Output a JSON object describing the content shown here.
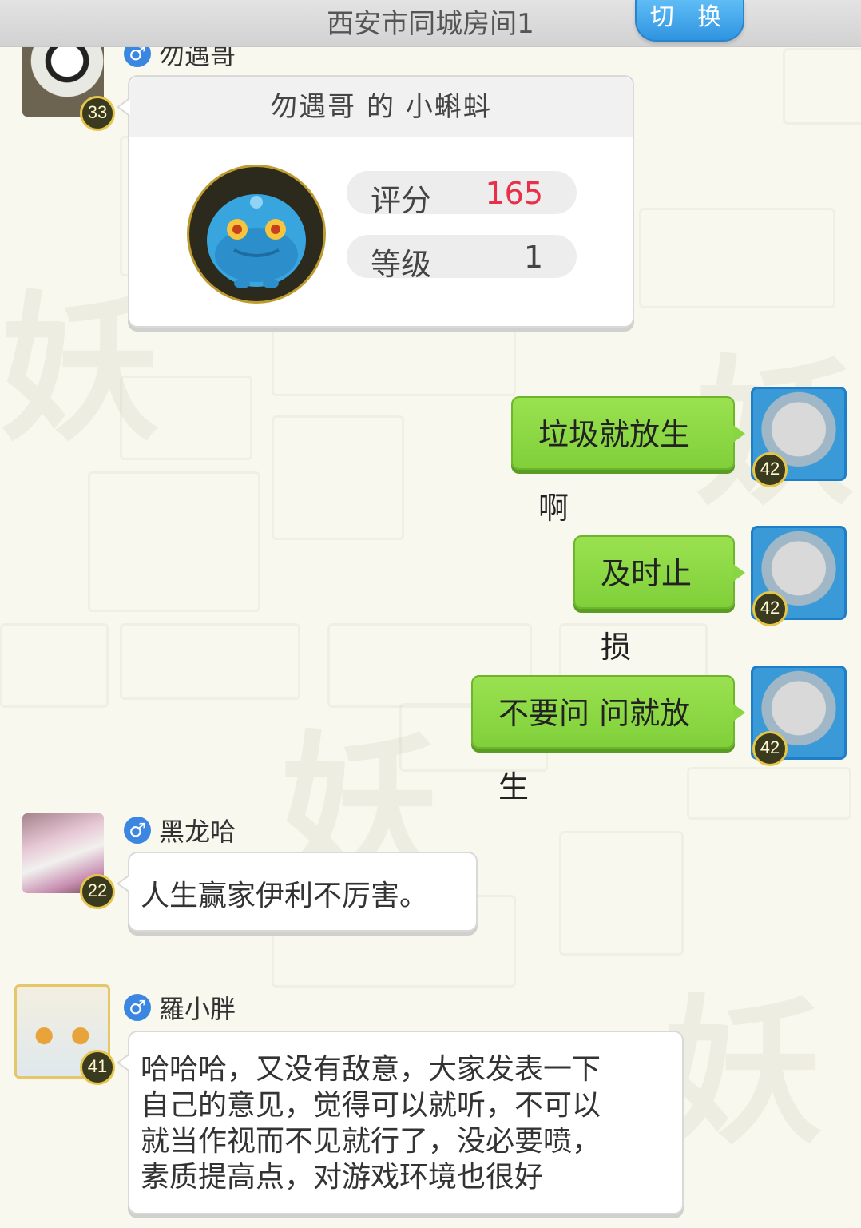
{
  "header": {
    "room_title": "西安市同城房间1",
    "switch_label": "切 换"
  },
  "messages": [
    {
      "user": "勿遇哥",
      "level": "33",
      "pet_card": {
        "title": "勿遇哥 的 小蝌蚪",
        "score_label": "评分",
        "score_value": "165",
        "grade_label": "等级",
        "grade_value": "1"
      }
    },
    {
      "self": true,
      "level": "42",
      "text": "垃圾就放生啊"
    },
    {
      "self": true,
      "level": "42",
      "text": "及时止损"
    },
    {
      "self": true,
      "level": "42",
      "text": "不要问 问就放生"
    },
    {
      "user": "黑龙哈",
      "gender": "♂",
      "level": "22",
      "text": "人生赢家伊利不厉害。"
    },
    {
      "user": "羅小胖",
      "gender": "♂",
      "level": "41",
      "lines": [
        "哈哈哈，又没有敌意，大家发表一下",
        "自己的意见，觉得可以就听，不可以",
        "就当作视而不见就行了，没必要喷，",
        "素质提高点，对游戏环境也很好"
      ]
    }
  ],
  "colors": {
    "score_value": "#e8304a",
    "self_bubble": "#8ad744",
    "switch_button": "#3aa0ea"
  }
}
